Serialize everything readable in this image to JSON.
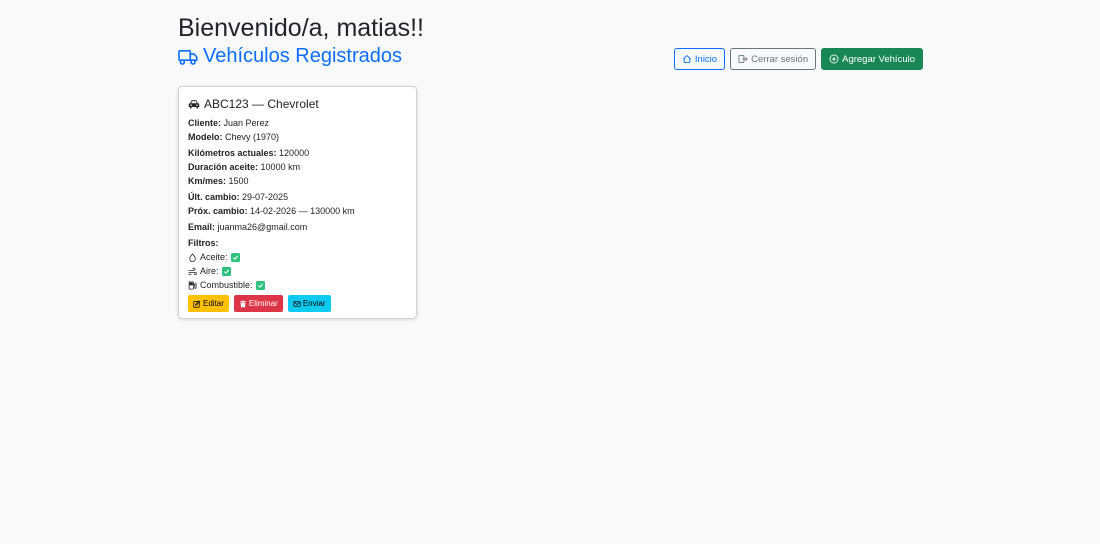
{
  "header": {
    "greeting": "Bienvenido/a, matias!!",
    "section_title": "Vehículos Registrados"
  },
  "toolbar": {
    "home_label": "Inicio",
    "logout_label": "Cerrar sesión",
    "add_label": "Agregar Vehículo"
  },
  "vehicle": {
    "title": "ABC123 — Chevrolet",
    "client_label": "Cliente:",
    "client": "Juan Perez",
    "model_label": "Modelo:",
    "model": "Chevy (1970)",
    "km_label": "Kilómetros actuales:",
    "km": "120000",
    "oil_duration_label": "Duración aceite:",
    "oil_duration": "10000 km",
    "km_month_label": "Km/mes:",
    "km_month": "1500",
    "last_change_label": "Últ. cambio:",
    "last_change": "29-07-2025",
    "next_change_label": "Próx. cambio:",
    "next_change": "14-02-2026 — 130000 km",
    "email_label": "Email:",
    "email": "juanma26@gmail.com",
    "filters_label": "Filtros:",
    "filters": [
      {
        "label": "Aceite:",
        "icon": "droplet-icon",
        "checked": true
      },
      {
        "label": "Aire:",
        "icon": "wind-icon",
        "checked": true
      },
      {
        "label": "Combustible:",
        "icon": "fuel-pump-icon",
        "checked": true
      }
    ],
    "edit_label": "Editar",
    "delete_label": "Eliminar",
    "send_label": "Enviar"
  },
  "colors": {
    "primary": "#0d6efd",
    "success": "#198754",
    "warning": "#ffc107",
    "danger": "#dc3545",
    "info": "#0dcaf0",
    "check": "#2ec27e"
  }
}
